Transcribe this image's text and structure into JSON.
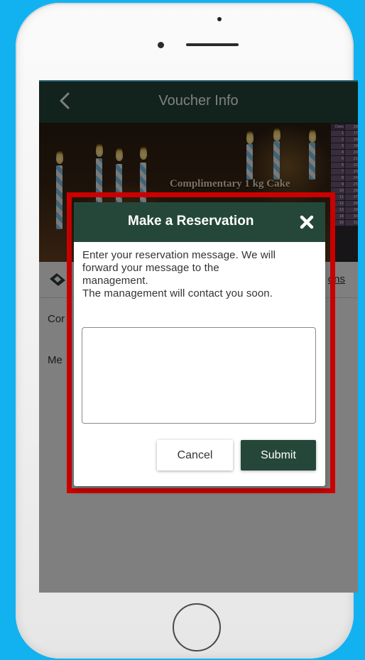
{
  "header": {
    "title": "Voucher Info"
  },
  "banner": {
    "caption": "Complimentary 1 kg Cake",
    "calendar": [
      "Date",
      "16",
      "1",
      "17",
      "2",
      "18",
      "3",
      "19",
      "4",
      "20",
      "5",
      "21",
      "6",
      "22",
      "7",
      "23",
      "8",
      "24",
      "9",
      "25",
      "10",
      "26",
      "11",
      "27",
      "12",
      "28",
      "13",
      "29",
      "14",
      "30",
      "15",
      "31"
    ]
  },
  "content": {
    "link_fragment": "ons",
    "line1_fragment": "Cor",
    "line2_fragment": "Me"
  },
  "dialog": {
    "title": "Make a Reservation",
    "message_lines": [
      "Enter your reservation message. We will",
      "forward your message to the",
      "management.",
      "The management will contact you soon."
    ],
    "message_input_value": "",
    "cancel_label": "Cancel",
    "submit_label": "Submit"
  },
  "colors": {
    "background": "#12b2f0",
    "brand_green": "#25473a",
    "highlight_red": "#cc0000"
  },
  "icons": {
    "back": "chevron-left-icon",
    "close": "close-icon",
    "ticket": "ticket-icon",
    "home": "home-button"
  }
}
